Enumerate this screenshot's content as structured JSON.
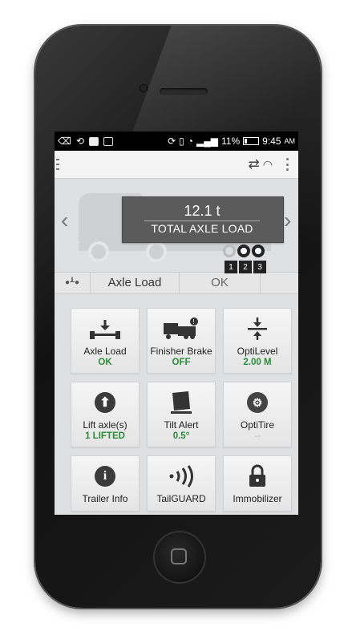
{
  "status_bar": {
    "battery": "11%",
    "time": "9:45",
    "am_pm": "AM"
  },
  "hero": {
    "load_value": "12.1 t",
    "load_label": "TOTAL AXLE LOAD",
    "axle_numbers": [
      "1",
      "2",
      "3"
    ]
  },
  "selector": {
    "label": "Axle Load",
    "value": "OK"
  },
  "tiles": [
    {
      "label": "Axle Load",
      "status": "OK",
      "icon": "axle-icon"
    },
    {
      "label": "Finisher Brake",
      "status": "OFF",
      "icon": "finisher-brake-icon"
    },
    {
      "label": "OptiLevel",
      "status": "2.00 M",
      "icon": "level-icon"
    },
    {
      "label": "Lift axle(s)",
      "status": "1 LIFTED",
      "icon": "lift-axle-icon"
    },
    {
      "label": "Tilt Alert",
      "status": "0.5°",
      "icon": "tilt-icon"
    },
    {
      "label": "OptiTire",
      "status": "--",
      "icon": "tire-icon"
    },
    {
      "label": "Trailer Info",
      "status": "",
      "icon": "info-icon"
    },
    {
      "label": "TailGUARD",
      "status": "",
      "icon": "sensor-icon"
    },
    {
      "label": "Immobilizer",
      "status": "",
      "icon": "lock-icon"
    }
  ],
  "colors": {
    "status_ok": "#2e8b3a",
    "load_box": "#5b5b5b"
  }
}
